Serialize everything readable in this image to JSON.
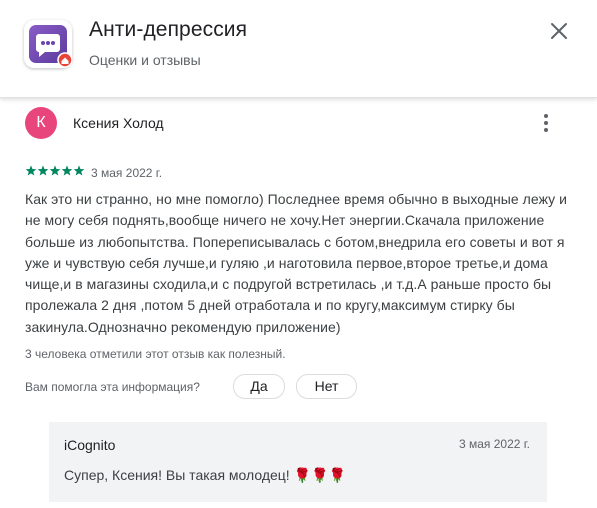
{
  "header": {
    "app_title": "Анти-депрессия",
    "subtitle": "Оценки и отзывы",
    "close_icon": "close-icon",
    "app_icon": "chat-bubble-app-icon"
  },
  "review": {
    "avatar_letter": "К",
    "avatar_color": "#e8457c",
    "author": "Ксения Холод",
    "rating": 5,
    "star_color": "#01875f",
    "date": "3 мая 2022 г.",
    "text": "Как это ни странно, но мне помогло) Последнее время обычно в выходные лежу и не могу себя поднять,вообще ничего не хочу.Нет энергии.Скачала приложение больше из любопытства. Попереписывалась с ботом,внедрила его советы и вот я уже и чувствую себя лучше,и гуляю ,и наготовила первое,второе третье,и дома чище,и в магазины сходила,и с подругой встретилась ,и т.д.А раньше просто бы пролежала 2 дня ,потом 5 дней отработала и по кругу,максимум стирку бы закинула.Однозначно рекомендую приложение)",
    "helpful_count": "3 человека отметили этот отзыв как полезный.",
    "helpful_question": "Вам помогла эта информация?",
    "yes_label": "Да",
    "no_label": "Нет"
  },
  "reply": {
    "author": "iCognito",
    "date": "3 мая 2022 г.",
    "text": "Супер, Ксения! Вы такая молодец! 🌹🌹🌹"
  }
}
